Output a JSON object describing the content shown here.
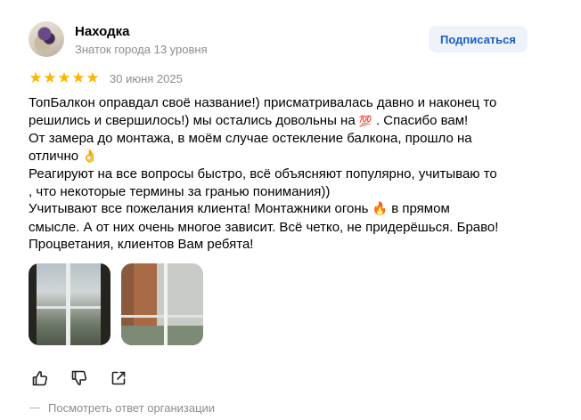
{
  "author": {
    "name": "Находка",
    "level": "Знаток города 13 уровня"
  },
  "subscribe_label": "Подписаться",
  "rating": {
    "value": 5,
    "max": 5,
    "color": "#fcb500"
  },
  "date": "30 июня 2025",
  "review": {
    "lines": [
      "ТопБалкон оправдал своё название!) присматривалась давно и наконец то",
      "решились и свершилось!) мы остались довольны на",
      " . Спасибо вам!",
      "От замера до монтажа, в моём случае остекление балкона, прошло на",
      "отлично",
      "Реагируют на все вопросы быстро, всё объясняют популярно, учитываю то",
      ", что некоторые термины за гранью понимания))",
      "Учитывают все пожелания клиента! Монтажники огонь",
      " в прямом",
      "смысле. А от них очень многое зависит. Всё четко, не придерёшься. Браво!",
      "Процветания, клиентов Вам ребята!"
    ],
    "emoji": [
      "hundred-points-emoji",
      "ok-hand-emoji",
      "fire-emoji"
    ]
  },
  "photos": [
    "balcony-photo-1",
    "balcony-photo-2"
  ],
  "actions": [
    "like-icon",
    "dislike-icon",
    "share-icon"
  ],
  "org_reply_label": "Посмотреть ответ организации",
  "colors": {
    "accent": "#1a5dc4",
    "subscribe_bg": "#eef3fb",
    "muted": "#8c8c8c"
  }
}
